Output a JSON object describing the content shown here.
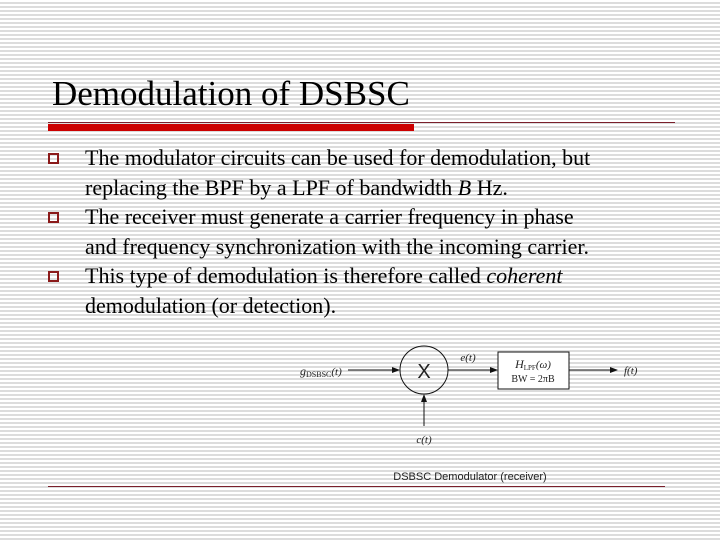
{
  "slide": {
    "title": "Demodulation of DSBSC",
    "accent_color": "#cc0000",
    "bullet_color": "#8b1a1a",
    "bullets": [
      {
        "lines": [
          "The modulator circuits can be used for demodulation, but",
          "replacing the BPF by a LPF of bandwidth B Hz."
        ],
        "line2_prefix": "replacing the BPF by a LPF of bandwidth ",
        "line2_italic": "B",
        "line2_suffix": " Hz."
      },
      {
        "lines": [
          "The receiver must generate a carrier frequency in phase",
          "and frequency synchronization with the incoming carrier."
        ]
      },
      {
        "lines": [
          "This type of demodulation is therefore called coherent",
          "demodulation (or detection)."
        ],
        "line1_prefix": "This type of demodulation is therefore called ",
        "line1_italic": "coherent"
      }
    ]
  },
  "diagram": {
    "input_label": "g",
    "input_subscript": "DSBSC",
    "input_arg": "(t)",
    "multiplier_symbol": "X",
    "carrier_label": "c(t)",
    "mixer_output_label": "e(t)",
    "filter_label": "H",
    "filter_subscript": "LPF",
    "filter_arg": "(ω)",
    "filter_bw": "BW = 2πB",
    "output_label": "f(t)",
    "caption": "DSBSC Demodulator (receiver)"
  }
}
